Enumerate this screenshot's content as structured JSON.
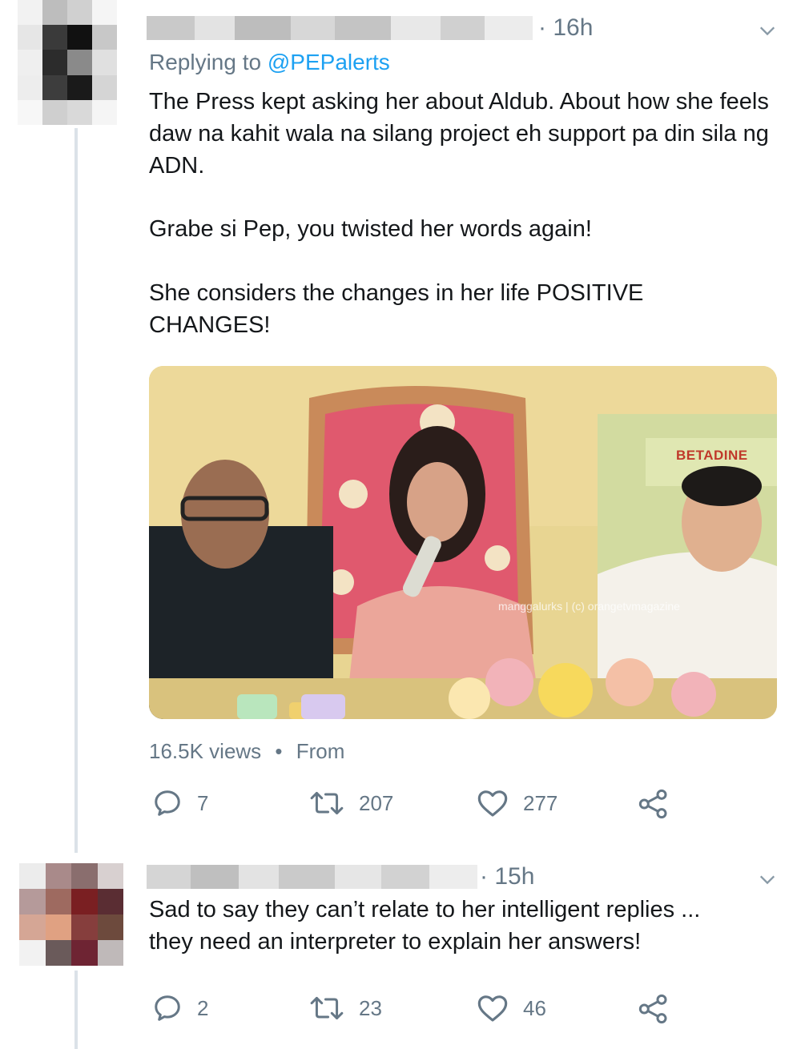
{
  "tweet1": {
    "time": "· 16h",
    "replying_prefix": "Replying to ",
    "replying_handle": "@PEPalerts",
    "paragraphs": [
      "The Press kept asking her about Aldub. About how she feels daw na kahit wala na silang project eh support pa din sila ng ADN.",
      "Grabe si Pep, you twisted her words again!",
      "She considers the changes in her life POSITIVE CHANGES!"
    ],
    "media": {
      "brand_sign": "BETADINE",
      "watermark": "manggalurks | (c) orangetvmagazine"
    },
    "views": "16.5K views",
    "dot": "•",
    "from": "From",
    "replies": "7",
    "retweets": "207",
    "likes": "277"
  },
  "tweet2": {
    "time": "· 15h",
    "lines": [
      "Sad to say they can’t relate to her intelligent replies ...",
      "they need an interpreter to explain her answers!"
    ],
    "replies": "2",
    "retweets": "23",
    "likes": "46"
  },
  "colors": {
    "text": "#14171a",
    "secondary": "#657786",
    "link": "#1da1f2",
    "thread_line": "#dbe2e8"
  },
  "icons": [
    "chevron-down-icon",
    "reply-icon",
    "retweet-icon",
    "like-icon",
    "share-icon"
  ]
}
